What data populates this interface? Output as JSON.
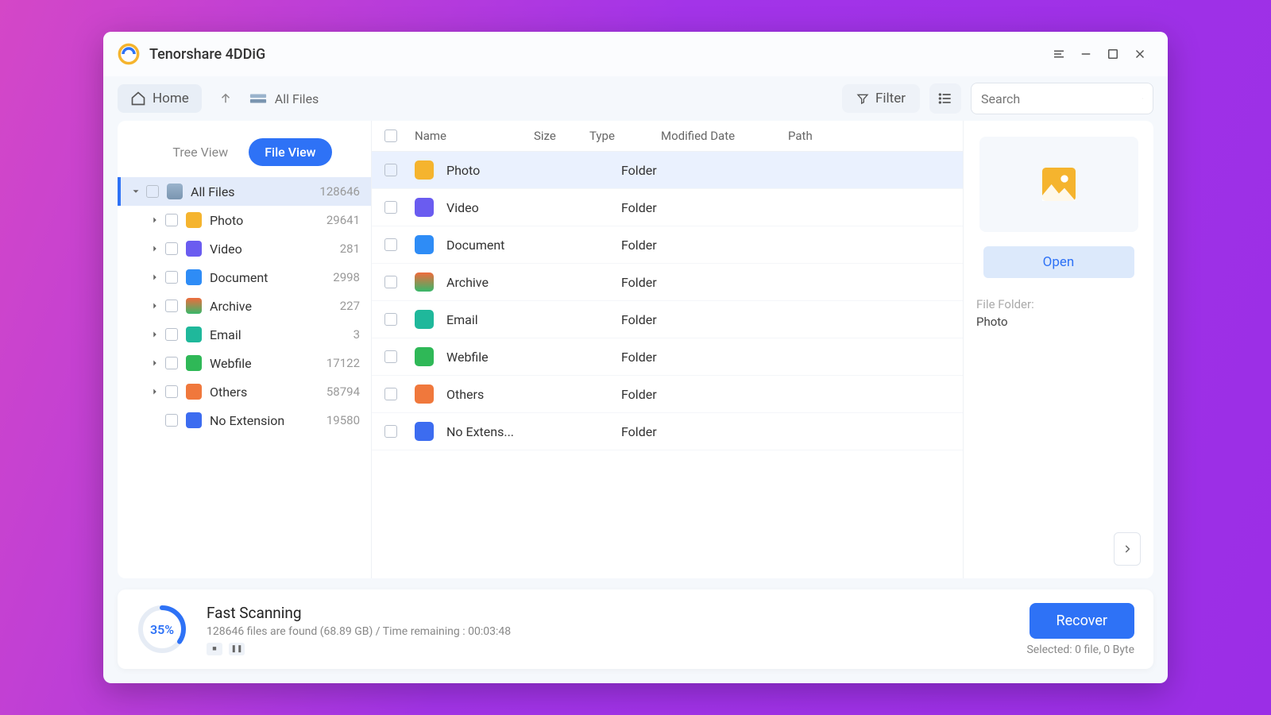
{
  "app": {
    "title": "Tenorshare 4DDiG"
  },
  "toolbar": {
    "home": "Home",
    "crumb": "All Files",
    "filter": "Filter",
    "search_placeholder": "Search"
  },
  "view_toggle": {
    "tree": "Tree View",
    "file": "File View"
  },
  "sidebar": {
    "root": {
      "label": "All Files",
      "count": "128646"
    },
    "items": [
      {
        "label": "Photo",
        "count": "29641",
        "icon": "ic-photo"
      },
      {
        "label": "Video",
        "count": "281",
        "icon": "ic-video"
      },
      {
        "label": "Document",
        "count": "2998",
        "icon": "ic-doc"
      },
      {
        "label": "Archive",
        "count": "227",
        "icon": "ic-arch"
      },
      {
        "label": "Email",
        "count": "3",
        "icon": "ic-email"
      },
      {
        "label": "Webfile",
        "count": "17122",
        "icon": "ic-web"
      },
      {
        "label": "Others",
        "count": "58794",
        "icon": "ic-other"
      },
      {
        "label": "No Extension",
        "count": "19580",
        "icon": "ic-noext"
      }
    ]
  },
  "columns": {
    "name": "Name",
    "size": "Size",
    "type": "Type",
    "mod": "Modified Date",
    "path": "Path"
  },
  "rows": [
    {
      "name": "Photo",
      "type": "Folder",
      "icon": "ic-photo",
      "high": true
    },
    {
      "name": "Video",
      "type": "Folder",
      "icon": "ic-video"
    },
    {
      "name": "Document",
      "type": "Folder",
      "icon": "ic-doc"
    },
    {
      "name": "Archive",
      "type": "Folder",
      "icon": "ic-arch"
    },
    {
      "name": "Email",
      "type": "Folder",
      "icon": "ic-email"
    },
    {
      "name": "Webfile",
      "type": "Folder",
      "icon": "ic-web"
    },
    {
      "name": "Others",
      "type": "Folder",
      "icon": "ic-other"
    },
    {
      "name": "No Extens...",
      "type": "Folder",
      "icon": "ic-noext"
    }
  ],
  "detail": {
    "open": "Open",
    "folder_key": "File Folder:",
    "folder_val": "Photo"
  },
  "footer": {
    "pct": "35%",
    "title": "Fast Scanning",
    "sub": "128646 files are found (68.89 GB) /  Time remaining : 00:03:48",
    "recover": "Recover",
    "selected": "Selected: 0 file, 0 Byte"
  }
}
